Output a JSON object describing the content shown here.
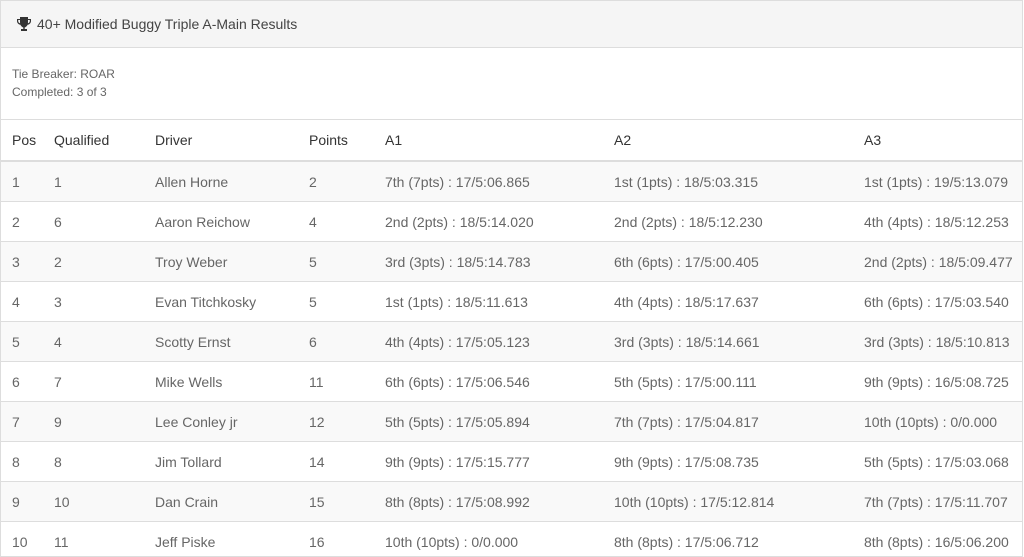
{
  "panel": {
    "title": "40+ Modified Buggy Triple A-Main Results",
    "title_icon": "trophy-icon"
  },
  "meta": {
    "tie_breaker": "Tie Breaker: ROAR",
    "completed": "Completed: 3 of 3"
  },
  "table": {
    "headers": [
      "Pos",
      "Qualified",
      "Driver",
      "Points",
      "A1",
      "A2",
      "A3"
    ],
    "rows": [
      [
        "1",
        "1",
        "Allen Horne",
        "2",
        "7th (7pts) : 17/5:06.865",
        "1st (1pts) : 18/5:03.315",
        "1st (1pts) : 19/5:13.079"
      ],
      [
        "2",
        "6",
        "Aaron Reichow",
        "4",
        "2nd (2pts) : 18/5:14.020",
        "2nd (2pts) : 18/5:12.230",
        "4th (4pts) : 18/5:12.253"
      ],
      [
        "3",
        "2",
        "Troy Weber",
        "5",
        "3rd (3pts) : 18/5:14.783",
        "6th (6pts) : 17/5:00.405",
        "2nd (2pts) : 18/5:09.477"
      ],
      [
        "4",
        "3",
        "Evan Titchkosky",
        "5",
        "1st (1pts) : 18/5:11.613",
        "4th (4pts) : 18/5:17.637",
        "6th (6pts) : 17/5:03.540"
      ],
      [
        "5",
        "4",
        "Scotty Ernst",
        "6",
        "4th (4pts) : 17/5:05.123",
        "3rd (3pts) : 18/5:14.661",
        "3rd (3pts) : 18/5:10.813"
      ],
      [
        "6",
        "7",
        "Mike Wells",
        "11",
        "6th (6pts) : 17/5:06.546",
        "5th (5pts) : 17/5:00.111",
        "9th (9pts) : 16/5:08.725"
      ],
      [
        "7",
        "9",
        "Lee Conley jr",
        "12",
        "5th (5pts) : 17/5:05.894",
        "7th (7pts) : 17/5:04.817",
        "10th (10pts) : 0/0.000"
      ],
      [
        "8",
        "8",
        "Jim Tollard",
        "14",
        "9th (9pts) : 17/5:15.777",
        "9th (9pts) : 17/5:08.735",
        "5th (5pts) : 17/5:03.068"
      ],
      [
        "9",
        "10",
        "Dan Crain",
        "15",
        "8th (8pts) : 17/5:08.992",
        "10th (10pts) : 17/5:12.814",
        "7th (7pts) : 17/5:11.707"
      ],
      [
        "10",
        "11",
        "Jeff Piske",
        "16",
        "10th (10pts) : 0/0.000",
        "8th (8pts) : 17/5:06.712",
        "8th (8pts) : 16/5:06.200"
      ]
    ]
  }
}
